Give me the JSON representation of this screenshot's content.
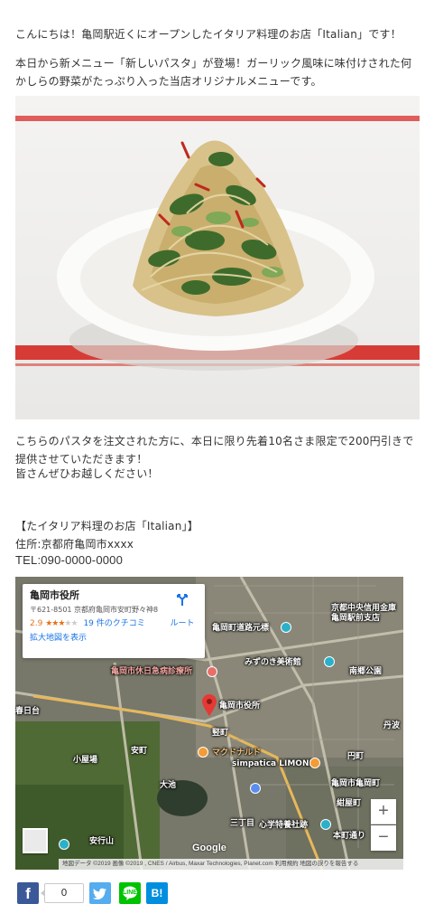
{
  "article": {
    "p1": "こんにちは！亀岡駅近くにオープンしたイタリア料理のお店「Italian」です！",
    "p2": "本日から新メニュー「新しいパスタ」が登場！ガーリック風味に味付けされた何かしらの野菜がたっぷり入った当店オリジナルメニューです。",
    "p3": "こちらのパスタを注文された方に、本日に限り先着10名さま限定で200円引きで提供させていただきます！",
    "p4": "皆さんぜひお越しください！",
    "store_name": "【たイタリア料理のお店「Italian」】",
    "address": "住所:京都府亀岡市xxxx",
    "tel": "TEL:090-0000-0000"
  },
  "map": {
    "place_name": "亀岡市役所",
    "address": "〒621-8501 京都府亀岡市安町野々神8",
    "rating": "2.9",
    "stars": "★★★",
    "stars_empty": "★★",
    "reviews": "19 件のクチコミ",
    "enlarge_link": "拡大地図を表示",
    "route_label": "ルート",
    "zoom_in": "+",
    "zoom_out": "−",
    "google": "Google",
    "attribution": "地図データ ©2019 画像 ©2019 , CNES / Airbus, Maxar Technologies, Planet.com   利用規約   地図の誤りを報告する",
    "labels": {
      "hospital": "亀岡市休日急病診療所",
      "cityhall": "亀岡市役所",
      "museum": "みずのき美術館",
      "mcdonalds": "マクドナルド",
      "simpatica": "simpatica LIMONE",
      "bank": "京都中央信用金庫 亀岡駅前支店",
      "road_origin": "亀岡町道路元標",
      "kawaramachi": "南郷公園",
      "yasumachi": "安町",
      "oike": "大池",
      "komiyagawa": "小屋場",
      "sho": "心学特養社跡",
      "kameoka_city": "亀岡市亀岡町",
      "ekimachi": "本町通り",
      "niwaka": "丹波",
      "nishimachi": "紺屋町",
      "yasuda": "安行山",
      "marumachi": "円町",
      "sanchome": "三丁目",
      "kasuga": "春日台",
      "tategataki": "竪町"
    }
  },
  "share": {
    "facebook_icon": "f",
    "facebook_count": "0",
    "line_label": "LINE",
    "hatena_label": "B!"
  }
}
